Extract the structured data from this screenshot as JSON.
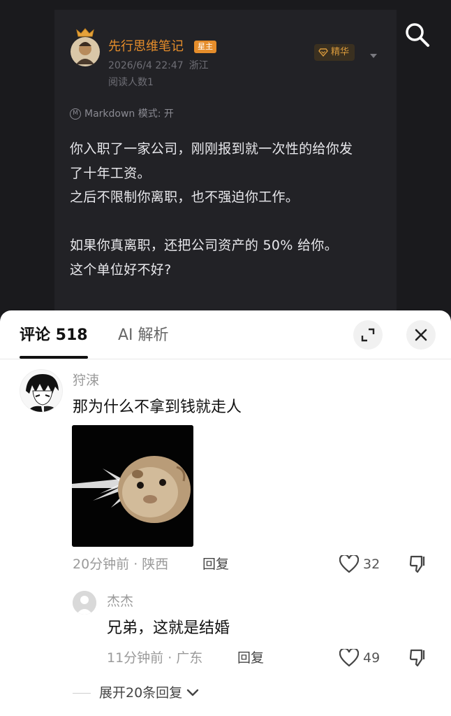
{
  "post": {
    "author": "先行思维笔记",
    "author_badge": "星主",
    "date": "2026/6/4 22:47",
    "location": "浙江",
    "reads": "阅读人数1",
    "elite_label": "精华",
    "markdown_label": "Markdown 模式: 开",
    "body_lines": [
      "你入职了一家公司，刚刚报到就一次性的给你发",
      "了十年工资。",
      "之后不限制你离职，也不强迫你工作。",
      "",
      "如果你真离职，还把公司资产的 50% 给你。",
      "这个单位好不好?"
    ]
  },
  "comments_panel": {
    "tab_comments": "评论 518",
    "tab_ai": "AI 解析",
    "comments": [
      {
        "name": "狩涑",
        "text": "那为什么不拿到钱就走人",
        "time": "20分钟前",
        "location": "陕西",
        "reply_label": "回复",
        "likes": "32",
        "replies": [
          {
            "name": "杰杰",
            "text": "兄弟，这就是结婚",
            "time": "11分钟前",
            "location": "广东",
            "reply_label": "回复",
            "likes": "49"
          }
        ],
        "expand_label": "展开20条回复"
      }
    ]
  },
  "colors": {
    "background": "#1a1a1d",
    "accent_orange": "#e58d2b",
    "sheet": "#ffffff"
  },
  "icons": [
    "search-icon",
    "crown-icon",
    "diamond-icon",
    "chevron-down-icon",
    "markdown-icon",
    "expand-icon",
    "close-icon",
    "heart-icon",
    "thumbs-down-icon",
    "user-icon"
  ]
}
